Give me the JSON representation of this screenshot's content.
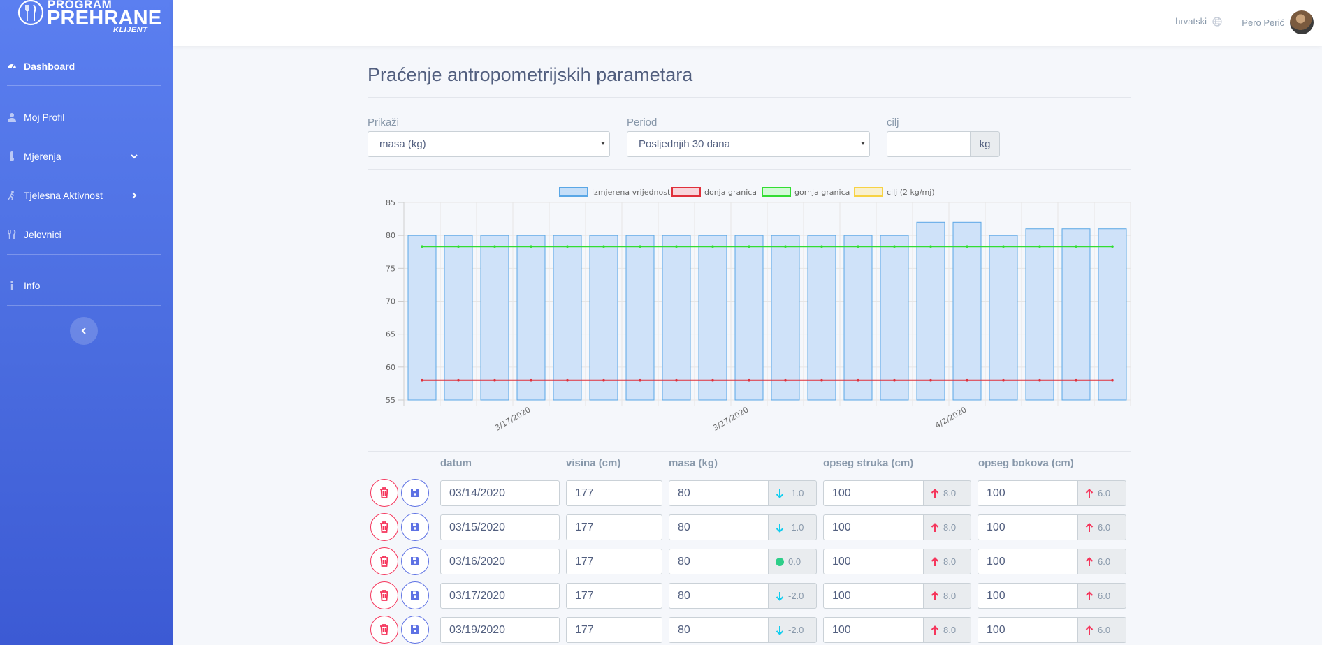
{
  "brand": {
    "line1": "PROGRAM",
    "line2": "PREHRANE",
    "line3": "KLIJENT"
  },
  "sidebar": {
    "items": [
      {
        "label": "Dashboard",
        "icon": "gauge-icon"
      },
      {
        "label": "Moj Profil",
        "icon": "user-icon"
      },
      {
        "label": "Mjerenja",
        "icon": "thermometer-icon"
      },
      {
        "label": "Tjelesna Aktivnost",
        "icon": "running-icon"
      },
      {
        "label": "Jelovnici",
        "icon": "utensils-icon"
      },
      {
        "label": "Info",
        "icon": "info-icon"
      }
    ]
  },
  "topbar": {
    "language": "hrvatski",
    "user_name": "Pero Perić"
  },
  "page": {
    "title": "Praćenje antropometrijskih parametara"
  },
  "filters": {
    "show_label": "Prikaži",
    "show_value": "masa (kg)",
    "period_label": "Period",
    "period_value": "Posljednjih 30 dana",
    "goal_label": "cilj",
    "goal_value": "",
    "goal_unit": "kg"
  },
  "chart_data": {
    "type": "bar",
    "legend": [
      "izmjerena vrijednost",
      "donja granica",
      "gornja granica",
      "cilj (2 kg/mj)"
    ],
    "colors": {
      "bar_fill": "#cfe2f9",
      "bar_stroke": "#5aa7e6",
      "lower": "#e0303b",
      "upper": "#33dd33",
      "goal": "#f7d244"
    },
    "x_tick_labels": [
      "3/17/2020",
      "3/27/2020",
      "4/2/2020"
    ],
    "yticks": [
      85,
      80,
      75,
      70,
      65,
      60,
      55
    ],
    "ylim": [
      55,
      85
    ],
    "values": [
      80,
      80,
      80,
      80,
      80,
      80,
      80,
      80,
      80,
      80,
      80,
      80,
      80,
      80,
      82,
      82,
      80,
      81,
      81,
      81
    ],
    "series": [
      {
        "name": "izmjerena vrijednost",
        "values": [
          80,
          80,
          80,
          80,
          80,
          80,
          80,
          80,
          80,
          80,
          80,
          80,
          80,
          80,
          82,
          82,
          80,
          81,
          81,
          81
        ]
      },
      {
        "name": "donja granica",
        "values": [
          58,
          58,
          58,
          58,
          58,
          58,
          58,
          58,
          58,
          58,
          58,
          58,
          58,
          58,
          58,
          58,
          58,
          58,
          58,
          58
        ]
      },
      {
        "name": "gornja granica",
        "values": [
          78.3,
          78.3,
          78.3,
          78.3,
          78.3,
          78.3,
          78.3,
          78.3,
          78.3,
          78.3,
          78.3,
          78.3,
          78.3,
          78.3,
          78.3,
          78.3,
          78.3,
          78.3,
          78.3,
          78.3
        ]
      }
    ]
  },
  "table": {
    "headers": [
      "datum",
      "visina (cm)",
      "masa (kg)",
      "opseg struka (cm)",
      "opseg bokova (cm)"
    ],
    "rows": [
      {
        "date": "03/14/2020",
        "height": "177",
        "mass": "80",
        "mass_delta": "-1.0",
        "mass_trend": "down",
        "waist": "100",
        "waist_delta": "8.0",
        "hips": "100",
        "hips_delta": "6.0"
      },
      {
        "date": "03/15/2020",
        "height": "177",
        "mass": "80",
        "mass_delta": "-1.0",
        "mass_trend": "down",
        "waist": "100",
        "waist_delta": "8.0",
        "hips": "100",
        "hips_delta": "6.0"
      },
      {
        "date": "03/16/2020",
        "height": "177",
        "mass": "80",
        "mass_delta": "0.0",
        "mass_trend": "same",
        "waist": "100",
        "waist_delta": "8.0",
        "hips": "100",
        "hips_delta": "6.0"
      },
      {
        "date": "03/17/2020",
        "height": "177",
        "mass": "80",
        "mass_delta": "-2.0",
        "mass_trend": "down",
        "waist": "100",
        "waist_delta": "8.0",
        "hips": "100",
        "hips_delta": "6.0"
      },
      {
        "date": "03/19/2020",
        "height": "177",
        "mass": "80",
        "mass_delta": "-2.0",
        "mass_trend": "down",
        "waist": "100",
        "waist_delta": "8.0",
        "hips": "100",
        "hips_delta": "6.0"
      }
    ]
  }
}
